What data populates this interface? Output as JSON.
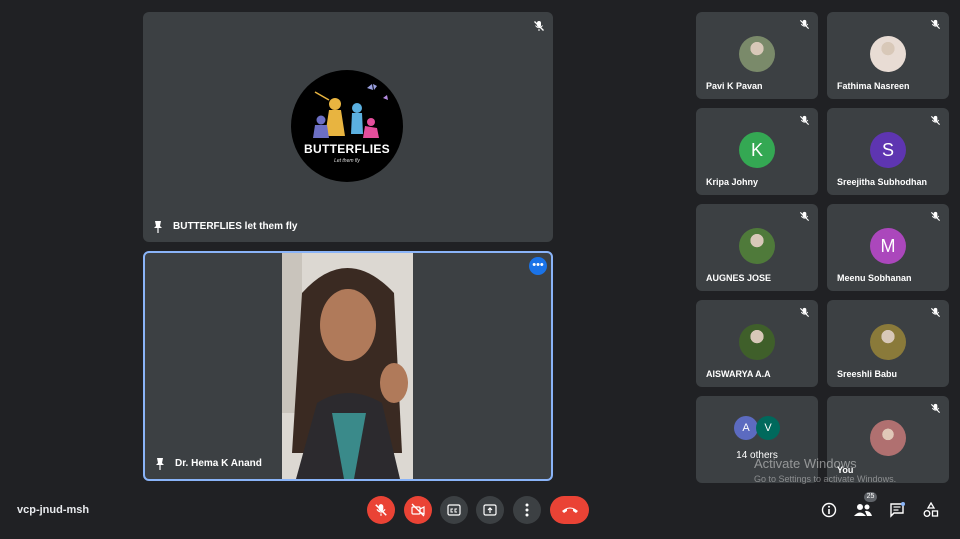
{
  "main_tiles": [
    {
      "name": "BUTTERFLIES let them fly",
      "logo_title": "BUTTERFLIES",
      "logo_subtitle": "Let them fly"
    },
    {
      "name": "Dr. Hema K Anand",
      "menu_glyph": "•••"
    }
  ],
  "participants": [
    {
      "name": "Pavi K Pavan",
      "initial": "",
      "avatar_color": "#7a8a6a",
      "photo": true
    },
    {
      "name": "Fathima Nasreen",
      "initial": "",
      "avatar_color": "#e8dcd4",
      "photo": true
    },
    {
      "name": "Kripa Johny",
      "initial": "K",
      "avatar_color": "#34a853"
    },
    {
      "name": "Sreejitha Subhodhan",
      "initial": "S",
      "avatar_color": "#5e35b1"
    },
    {
      "name": "AUGNES JOSE",
      "initial": "",
      "avatar_color": "#4f7a3a",
      "photo": true
    },
    {
      "name": "Meenu Sobhanan",
      "initial": "M",
      "avatar_color": "#ab47bc"
    },
    {
      "name": "AISWARYA A.A",
      "initial": "",
      "avatar_color": "#3f5f2a",
      "photo": true
    },
    {
      "name": "Sreeshli Babu",
      "initial": "",
      "avatar_color": "#8a7a3a",
      "photo": true
    }
  ],
  "others": {
    "label": "14 others",
    "initials": [
      "A",
      "V"
    ],
    "colors": [
      "#5c6bc0",
      "#00695c"
    ]
  },
  "you": {
    "name": "You",
    "avatar_color": "#b07070"
  },
  "watermark": {
    "title": "Activate Windows",
    "subtitle": "Go to Settings to activate Windows."
  },
  "meeting_code": "vcp-jnud-msh",
  "participant_count": "25",
  "colors": {
    "background": "#202124",
    "tile": "#3c4043",
    "red": "#ea4335",
    "active_border": "#8ab4f8"
  }
}
